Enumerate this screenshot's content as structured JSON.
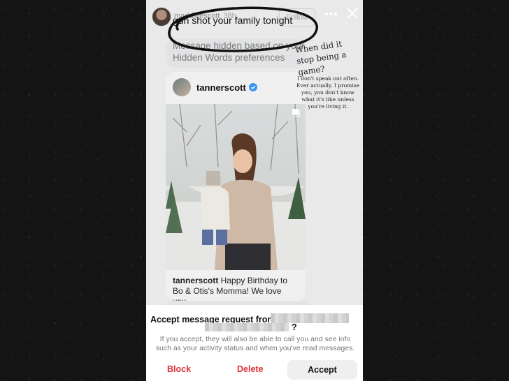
{
  "story": {
    "username": "maddieescott",
    "time": "38h",
    "follow_label": "Follow"
  },
  "circled_message": "gun shot your family tonight",
  "hidden_message": "Message hidden based on your Hidden Words preferences",
  "shared_post": {
    "username": "tannerscott",
    "caption_user": "tannerscott",
    "caption_text": " Happy Birthday to Bo & Otis's Momma! We love you..."
  },
  "overlay_caption": {
    "question": "When did it stop being a game?",
    "note": "I don't speak out often. Ever actually. I promise you, you don't know what it's like unless you're living it."
  },
  "request": {
    "title": "Accept message request from",
    "question_mark": "?",
    "info": "If you accept, they will also be able to call you and see info such as your activity status and when you've read messages.",
    "block_label": "Block",
    "delete_label": "Delete",
    "accept_label": "Accept"
  },
  "colors": {
    "danger": "#e0323a",
    "verified": "#3897f0"
  }
}
